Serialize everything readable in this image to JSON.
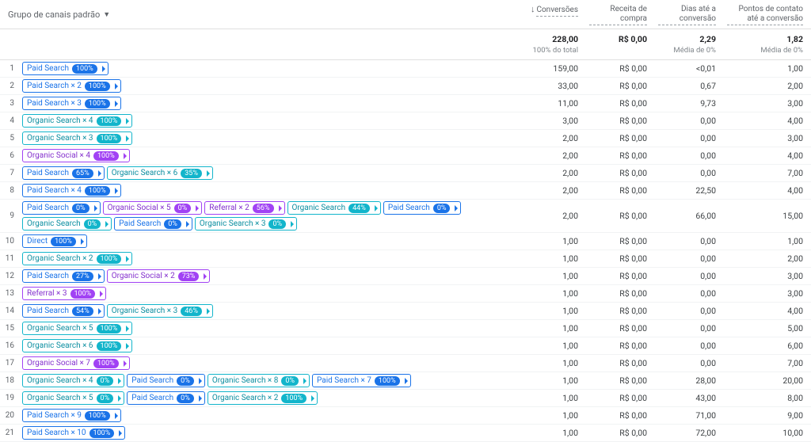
{
  "header": {
    "dimension_label": "Grupo de canais padrão",
    "columns": [
      {
        "label": "Conversões",
        "sorted_desc": true
      },
      {
        "label": "Receita de compra"
      },
      {
        "label": "Dias até a conversão"
      },
      {
        "label": "Pontos de contato até a conversão",
        "wide": true
      }
    ]
  },
  "totals": {
    "conversoes": "228,00",
    "conversoes_sub": "100% do total",
    "receita": "R$ 0,00",
    "dias": "2,29",
    "dias_sub": "Média de 0%",
    "pontos": "1,82",
    "pontos_sub": "Média de 0%"
  },
  "chip_types": {
    "Paid Search": "blue",
    "Organic Search": "teal",
    "Organic Social": "purple",
    "Referral": "purple",
    "Direct": "blue"
  },
  "rows": [
    {
      "chips": [
        {
          "name": "Paid Search",
          "pct": "100%"
        }
      ],
      "v": [
        "159,00",
        "R$ 0,00",
        "<0,01",
        "1,00"
      ]
    },
    {
      "chips": [
        {
          "name": "Paid Search × 2",
          "pct": "100%"
        }
      ],
      "v": [
        "33,00",
        "R$ 0,00",
        "0,67",
        "2,00"
      ]
    },
    {
      "chips": [
        {
          "name": "Paid Search × 3",
          "pct": "100%"
        }
      ],
      "v": [
        "11,00",
        "R$ 0,00",
        "9,73",
        "3,00"
      ]
    },
    {
      "chips": [
        {
          "name": "Organic Search × 4",
          "pct": "100%"
        }
      ],
      "v": [
        "3,00",
        "R$ 0,00",
        "0,00",
        "4,00"
      ]
    },
    {
      "chips": [
        {
          "name": "Organic Search × 3",
          "pct": "100%"
        }
      ],
      "v": [
        "2,00",
        "R$ 0,00",
        "0,00",
        "3,00"
      ]
    },
    {
      "chips": [
        {
          "name": "Organic Social × 4",
          "pct": "100%"
        }
      ],
      "v": [
        "2,00",
        "R$ 0,00",
        "0,00",
        "4,00"
      ]
    },
    {
      "chips": [
        {
          "name": "Paid Search",
          "pct": "65%"
        },
        {
          "name": "Organic Search × 6",
          "pct": "35%"
        }
      ],
      "v": [
        "2,00",
        "R$ 0,00",
        "0,00",
        "7,00"
      ]
    },
    {
      "chips": [
        {
          "name": "Paid Search × 4",
          "pct": "100%"
        }
      ],
      "v": [
        "2,00",
        "R$ 0,00",
        "22,50",
        "4,00"
      ]
    },
    {
      "chips": [
        {
          "name": "Paid Search",
          "pct": "0%"
        },
        {
          "name": "Organic Social × 5",
          "pct": "0%"
        },
        {
          "name": "Referral × 2",
          "pct": "56%"
        },
        {
          "name": "Organic Search",
          "pct": "44%"
        },
        {
          "name": "Paid Search",
          "pct": "0%"
        },
        {
          "name": "Organic Search",
          "pct": "0%"
        },
        {
          "name": "Paid Search",
          "pct": "0%"
        },
        {
          "name": "Organic Search × 3",
          "pct": "0%"
        }
      ],
      "v": [
        "2,00",
        "R$ 0,00",
        "66,00",
        "15,00"
      ]
    },
    {
      "chips": [
        {
          "name": "Direct",
          "pct": "100%"
        }
      ],
      "v": [
        "1,00",
        "R$ 0,00",
        "0,00",
        "1,00"
      ]
    },
    {
      "chips": [
        {
          "name": "Organic Search × 2",
          "pct": "100%"
        }
      ],
      "v": [
        "1,00",
        "R$ 0,00",
        "0,00",
        "2,00"
      ]
    },
    {
      "chips": [
        {
          "name": "Paid Search",
          "pct": "27%"
        },
        {
          "name": "Organic Social × 2",
          "pct": "73%"
        }
      ],
      "v": [
        "1,00",
        "R$ 0,00",
        "0,00",
        "3,00"
      ]
    },
    {
      "chips": [
        {
          "name": "Referral × 3",
          "pct": "100%"
        }
      ],
      "v": [
        "1,00",
        "R$ 0,00",
        "0,00",
        "3,00"
      ]
    },
    {
      "chips": [
        {
          "name": "Paid Search",
          "pct": "54%"
        },
        {
          "name": "Organic Search × 3",
          "pct": "46%"
        }
      ],
      "v": [
        "1,00",
        "R$ 0,00",
        "0,00",
        "4,00"
      ]
    },
    {
      "chips": [
        {
          "name": "Organic Search × 5",
          "pct": "100%"
        }
      ],
      "v": [
        "1,00",
        "R$ 0,00",
        "0,00",
        "5,00"
      ]
    },
    {
      "chips": [
        {
          "name": "Organic Search × 6",
          "pct": "100%"
        }
      ],
      "v": [
        "1,00",
        "R$ 0,00",
        "0,00",
        "6,00"
      ]
    },
    {
      "chips": [
        {
          "name": "Organic Social × 7",
          "pct": "100%"
        }
      ],
      "v": [
        "1,00",
        "R$ 0,00",
        "0,00",
        "7,00"
      ]
    },
    {
      "chips": [
        {
          "name": "Organic Search × 4",
          "pct": "0%"
        },
        {
          "name": "Paid Search",
          "pct": "0%"
        },
        {
          "name": "Organic Search × 8",
          "pct": "0%"
        },
        {
          "name": "Paid Search × 7",
          "pct": "100%"
        }
      ],
      "v": [
        "1,00",
        "R$ 0,00",
        "28,00",
        "20,00"
      ]
    },
    {
      "chips": [
        {
          "name": "Organic Search × 5",
          "pct": "0%"
        },
        {
          "name": "Paid Search",
          "pct": "0%"
        },
        {
          "name": "Organic Search × 2",
          "pct": "100%"
        }
      ],
      "v": [
        "1,00",
        "R$ 0,00",
        "43,00",
        "8,00"
      ]
    },
    {
      "chips": [
        {
          "name": "Paid Search × 9",
          "pct": "100%"
        }
      ],
      "v": [
        "1,00",
        "R$ 0,00",
        "71,00",
        "9,00"
      ]
    },
    {
      "chips": [
        {
          "name": "Paid Search × 10",
          "pct": "100%"
        }
      ],
      "v": [
        "1,00",
        "R$ 0,00",
        "72,00",
        "10,00"
      ]
    }
  ]
}
